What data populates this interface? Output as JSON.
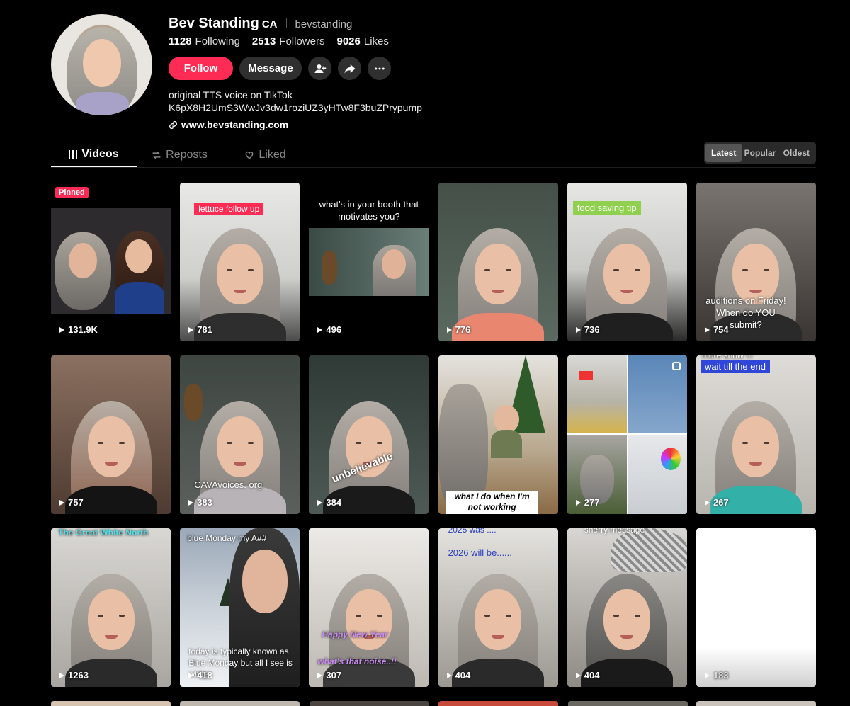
{
  "profile": {
    "name": "Bev Standing",
    "region": "CA",
    "handle": "bevstanding",
    "following_count": "1128",
    "following_label": "Following",
    "followers_count": "2513",
    "followers_label": "Followers",
    "likes_count": "9026",
    "likes_label": "Likes",
    "follow_label": "Follow",
    "message_label": "Message",
    "bio_line1": "original TTS voice on TikTok",
    "bio_line2": "K6pX8H2UmS3WwJv3dw1roziUZ3yHTw8F3buZPrypump",
    "website": "www.bevstanding.com"
  },
  "tabs": [
    {
      "label": "Videos",
      "icon": "grid-icon"
    },
    {
      "label": "Reposts",
      "icon": "repost-icon"
    },
    {
      "label": "Liked",
      "icon": "heart-icon"
    }
  ],
  "sort": [
    "Latest",
    "Popular",
    "Oldest"
  ],
  "colors": {
    "accent": "#fe2c55",
    "button_dark": "#2f2f2f",
    "background": "#000000"
  },
  "videos": [
    {
      "views": "131.9K",
      "badge": "Pinned"
    },
    {
      "views": "781",
      "caption": "lettuce follow up"
    },
    {
      "views": "496",
      "caption": "what's in your booth that motivates you?"
    },
    {
      "views": "776"
    },
    {
      "views": "736",
      "caption": "food saving tip"
    },
    {
      "views": "754",
      "caption": "auditions on Friday! When do YOU submit?"
    },
    {
      "views": "757"
    },
    {
      "views": "383",
      "caption": "CAVAvoices. org"
    },
    {
      "views": "384",
      "caption": "unbelievable"
    },
    {
      "views": "",
      "caption": "what I do when I'm not working"
    },
    {
      "views": "277"
    },
    {
      "views": "267",
      "caption": "wait till the end",
      "caption_top": "more snow !!!"
    },
    {
      "views": "1263",
      "caption": "The Great White North"
    },
    {
      "views": "418",
      "caption": "blue Monday my A##",
      "caption2": "today is typically known as Blue Monday but all I see is white"
    },
    {
      "views": "307",
      "caption": "Happy New Year",
      "caption2": "what's that noise..!!"
    },
    {
      "views": "404",
      "caption": "2025 was ....",
      "caption2": "2026 will be......"
    },
    {
      "views": "404",
      "caption": "sherry message"
    },
    {
      "views": "183"
    }
  ]
}
